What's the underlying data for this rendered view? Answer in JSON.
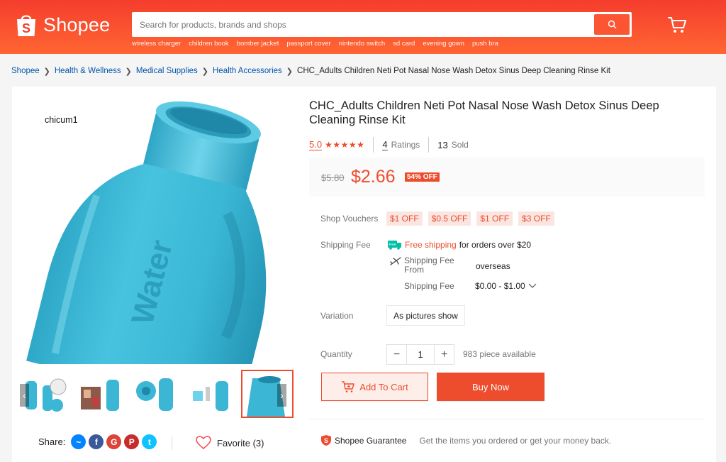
{
  "header": {
    "logo_text": "Shopee",
    "search_placeholder": "Search for products, brands and shops",
    "hints": [
      "wireless charger",
      "children book",
      "bomber jacket",
      "passport cover",
      "nintendo switch",
      "sd card",
      "evening gown",
      "push bra"
    ]
  },
  "breadcrumb": {
    "items": [
      "Shopee",
      "Health & Wellness",
      "Medical Supplies",
      "Health Accessories"
    ],
    "current": "CHC_Adults Children Neti Pot Nasal Nose Wash Detox Sinus Deep Cleaning Rinse Kit"
  },
  "gallery": {
    "watermark": "chicum1",
    "main_image_text": "Water",
    "thumbnails": [
      "thumb-1",
      "thumb-2",
      "thumb-3",
      "thumb-4",
      "thumb-5"
    ],
    "active_thumbnail": 5
  },
  "share": {
    "label": "Share:",
    "favorite_label": "Favorite (3)"
  },
  "product": {
    "title": "CHC_Adults Children Neti Pot Nasal Nose Wash Detox Sinus Deep Cleaning Rinse Kit",
    "rating": "5.0",
    "stars": 5,
    "ratings_count": "4",
    "ratings_label": "Ratings",
    "sold_count": "13",
    "sold_label": "Sold",
    "old_price": "$5.80",
    "price": "$2.66",
    "discount": "54% OFF"
  },
  "vouchers": {
    "label": "Shop Vouchers",
    "items": [
      "$1 OFF",
      "$0.5 OFF",
      "$1 OFF",
      "$3 OFF"
    ]
  },
  "shipping": {
    "label": "Shipping Fee",
    "free_badge": "Free",
    "free_text": "Free shipping",
    "free_suffix": "for orders over $20",
    "from_label": "Shipping Fee From",
    "from_value": "overseas",
    "fee_label": "Shipping Fee",
    "fee_value": "$0.00 - $1.00"
  },
  "variation": {
    "label": "Variation",
    "option": "As pictures show"
  },
  "quantity": {
    "label": "Quantity",
    "value": "1",
    "minus": "−",
    "plus": "+",
    "available": "983 piece available"
  },
  "actions": {
    "add_to_cart": "Add To Cart",
    "buy_now": "Buy Now"
  },
  "guarantee": {
    "title": "Shopee Guarantee",
    "description": "Get the items you ordered or get your money back."
  },
  "colors": {
    "brand": "#ee4d2d",
    "header_start": "#f53d2d",
    "header_end": "#ff6633"
  }
}
